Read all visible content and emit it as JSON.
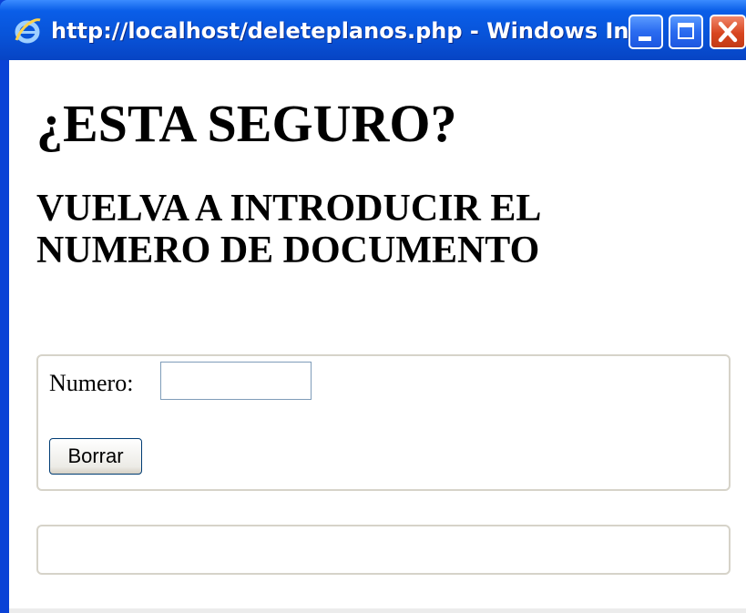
{
  "window": {
    "title": "http://localhost/deleteplanos.php - Windows In...",
    "icons": {
      "app": "internet-explorer-icon",
      "minimize": "minimize-icon",
      "maximize": "maximize-icon",
      "close": "close-icon"
    }
  },
  "page": {
    "heading": "¿ESTA SEGURO?",
    "subheading": "VUELVA A INTRODUCIR EL NUMERO DE DOCUMENTO",
    "form": {
      "numero_label": "Numero:",
      "numero_value": "",
      "submit_label": "Borrar"
    }
  },
  "colors": {
    "titlebar": "#0853d8",
    "close_button": "#d8451f"
  }
}
